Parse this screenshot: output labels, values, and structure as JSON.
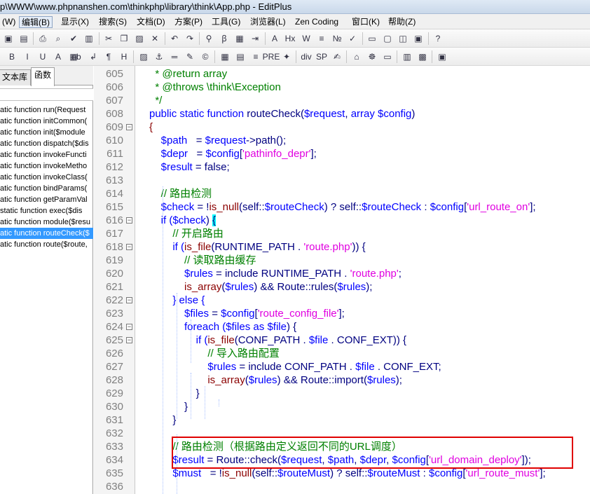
{
  "window": {
    "title": "p\\WWW\\www.phpnanshen.com\\thinkphp\\library\\think\\App.php - EditPlus"
  },
  "menubar": {
    "items": [
      {
        "label": "(W)",
        "active": false
      },
      {
        "label": "编辑(B)",
        "active": true
      },
      {
        "label": "显示(X)",
        "active": false
      },
      {
        "label": "搜索(S)",
        "active": false
      },
      {
        "label": "文档(D)",
        "active": false
      },
      {
        "label": "方案(P)",
        "active": false
      },
      {
        "label": "工具(G)",
        "active": false
      },
      {
        "label": "浏览器(L)",
        "active": false
      },
      {
        "label": "Zen Coding",
        "active": false
      },
      {
        "label": "窗口(K)",
        "active": false
      },
      {
        "label": "帮助(Z)",
        "active": false
      }
    ]
  },
  "toolbar1": {
    "buttons": [
      {
        "icon": "save-icon",
        "glyph": "▣"
      },
      {
        "icon": "save-all-icon",
        "glyph": "▤"
      },
      {
        "icon": "print-icon",
        "glyph": "⎙"
      },
      {
        "icon": "print-preview-icon",
        "glyph": "⌕"
      },
      {
        "icon": "spell-check-icon",
        "glyph": "✔"
      },
      {
        "icon": "page-setup-icon",
        "glyph": "▥"
      },
      {
        "icon": "cut-icon",
        "glyph": "✂"
      },
      {
        "icon": "copy-icon",
        "glyph": "❐"
      },
      {
        "icon": "paste-icon",
        "glyph": "▨"
      },
      {
        "icon": "delete-icon",
        "glyph": "✕"
      },
      {
        "icon": "undo-icon",
        "glyph": "↶"
      },
      {
        "icon": "redo-icon",
        "glyph": "↷"
      },
      {
        "icon": "find-icon",
        "glyph": "⚲"
      },
      {
        "icon": "replace-icon",
        "glyph": "ꞵ"
      },
      {
        "icon": "find-in-files-icon",
        "glyph": "▦"
      },
      {
        "icon": "goto-line-icon",
        "glyph": "⇥"
      },
      {
        "icon": "font-icon",
        "glyph": "A"
      },
      {
        "icon": "hex-view-icon",
        "glyph": "Hx"
      },
      {
        "icon": "word-wrap-icon",
        "glyph": "W"
      },
      {
        "icon": "ruler-icon",
        "glyph": "≡"
      },
      {
        "icon": "line-number-icon",
        "glyph": "№"
      },
      {
        "icon": "spell-icon",
        "glyph": "✓"
      },
      {
        "icon": "window-list-icon",
        "glyph": "▭"
      },
      {
        "icon": "preview-icon",
        "glyph": "▢"
      },
      {
        "icon": "browser-icon",
        "glyph": "◫"
      },
      {
        "icon": "clip-icon",
        "glyph": "▣"
      },
      {
        "icon": "help-cursor-icon",
        "glyph": "?"
      }
    ]
  },
  "toolbar2": {
    "buttons": [
      {
        "icon": "bold-icon",
        "glyph": "B"
      },
      {
        "icon": "italic-icon",
        "glyph": "I"
      },
      {
        "icon": "underline-icon",
        "glyph": "U"
      },
      {
        "icon": "font-color-icon",
        "glyph": "A"
      },
      {
        "icon": "color-grid-icon",
        "glyph": "▦"
      },
      {
        "icon": "nbsp-icon",
        "glyph": "nb"
      },
      {
        "icon": "line-break-icon",
        "glyph": "↲"
      },
      {
        "icon": "paragraph-icon",
        "glyph": "¶"
      },
      {
        "icon": "heading-icon",
        "glyph": "H"
      },
      {
        "icon": "image-icon",
        "glyph": "▨"
      },
      {
        "icon": "anchor-icon",
        "glyph": "⚓"
      },
      {
        "icon": "hr-icon",
        "glyph": "═"
      },
      {
        "icon": "edit-icon",
        "glyph": "✎"
      },
      {
        "icon": "comment-icon",
        "glyph": "©"
      },
      {
        "icon": "table-icon",
        "glyph": "▦"
      },
      {
        "icon": "form-icon",
        "glyph": "▤"
      },
      {
        "icon": "center-icon",
        "glyph": "≡"
      },
      {
        "icon": "pre-icon",
        "glyph": "PRE"
      },
      {
        "icon": "script-icon",
        "glyph": "✦"
      },
      {
        "icon": "div-icon",
        "glyph": "div"
      },
      {
        "icon": "span-icon",
        "glyph": "SP"
      },
      {
        "icon": "clip-library-icon",
        "glyph": "✍"
      },
      {
        "icon": "tag-icon",
        "glyph": "⌂"
      },
      {
        "icon": "css-icon",
        "glyph": "☸"
      },
      {
        "icon": "frame-icon",
        "glyph": "▭"
      },
      {
        "icon": "layout-icon",
        "glyph": "▥"
      },
      {
        "icon": "palette-icon",
        "glyph": "▩"
      },
      {
        "icon": "browser-view-icon",
        "glyph": "▣"
      }
    ]
  },
  "sidebar": {
    "tabs": [
      {
        "label": "文本库",
        "active": false
      },
      {
        "label": "函数",
        "active": true
      }
    ],
    "functions": [
      {
        "label": "atic function run(Request",
        "selected": false
      },
      {
        "label": "atic function initCommon(",
        "selected": false
      },
      {
        "label": "atic function init($module",
        "selected": false
      },
      {
        "label": "atic function dispatch($dis",
        "selected": false
      },
      {
        "label": "atic function invokeFuncti",
        "selected": false
      },
      {
        "label": "atic function invokeMetho",
        "selected": false
      },
      {
        "label": "atic function invokeClass(",
        "selected": false
      },
      {
        "label": "atic function bindParams(",
        "selected": false
      },
      {
        "label": "atic function getParamVal",
        "selected": false
      },
      {
        "label": " static function exec($dis",
        "selected": false
      },
      {
        "label": "atic function module($resu",
        "selected": false
      },
      {
        "label": "atic function routeCheck($",
        "selected": true
      },
      {
        "label": "atic function route($route,",
        "selected": false
      }
    ]
  },
  "editor": {
    "colors": {
      "keyword": "#0000ff",
      "variable": "#0000ff",
      "string": "#e000e0",
      "comment": "#008000",
      "function": "#8b0000",
      "text": "#000080"
    },
    "lines": [
      {
        "n": "605",
        "fold": "",
        "tokens": [
          {
            "t": "  * @return array",
            "c": "comment"
          }
        ]
      },
      {
        "n": "606",
        "fold": "",
        "tokens": [
          {
            "t": "  * @throws \\think\\Exception",
            "c": "comment"
          }
        ]
      },
      {
        "n": "607",
        "fold": "",
        "tokens": [
          {
            "t": "  */",
            "c": "comment"
          }
        ]
      },
      {
        "n": "608",
        "fold": "",
        "tokens": [
          {
            "t": "public static function ",
            "c": "keyword"
          },
          {
            "t": "routeCheck",
            "c": "text"
          },
          {
            "t": "(",
            "c": "text"
          },
          {
            "t": "$request",
            "c": "variable"
          },
          {
            "t": ", ",
            "c": "text"
          },
          {
            "t": "array ",
            "c": "keyword"
          },
          {
            "t": "$config",
            "c": "variable"
          },
          {
            "t": ")",
            "c": "text"
          }
        ]
      },
      {
        "n": "609",
        "fold": "−",
        "tokens": [
          {
            "t": "{",
            "c": "function"
          }
        ]
      },
      {
        "n": "610",
        "fold": "",
        "tokens": [
          {
            "t": "    $path",
            "c": "variable"
          },
          {
            "t": "   = ",
            "c": "text"
          },
          {
            "t": "$request",
            "c": "variable"
          },
          {
            "t": "->path();",
            "c": "text"
          }
        ]
      },
      {
        "n": "611",
        "fold": "",
        "tokens": [
          {
            "t": "    $depr",
            "c": "variable"
          },
          {
            "t": "   = ",
            "c": "text"
          },
          {
            "t": "$config",
            "c": "variable"
          },
          {
            "t": "[",
            "c": "text"
          },
          {
            "t": "'pathinfo_depr'",
            "c": "string"
          },
          {
            "t": "];",
            "c": "text"
          }
        ]
      },
      {
        "n": "612",
        "fold": "",
        "tokens": [
          {
            "t": "    $result",
            "c": "variable"
          },
          {
            "t": " = false;",
            "c": "text"
          }
        ]
      },
      {
        "n": "613",
        "fold": "",
        "tokens": []
      },
      {
        "n": "614",
        "fold": "",
        "tokens": [
          {
            "t": "    // 路由检测",
            "c": "comment"
          }
        ]
      },
      {
        "n": "615",
        "fold": "",
        "tokens": [
          {
            "t": "    $check",
            "c": "variable"
          },
          {
            "t": " = !",
            "c": "text"
          },
          {
            "t": "is_null",
            "c": "function"
          },
          {
            "t": "(self::",
            "c": "text"
          },
          {
            "t": "$routeCheck",
            "c": "variable"
          },
          {
            "t": ") ? self::",
            "c": "text"
          },
          {
            "t": "$routeCheck",
            "c": "variable"
          },
          {
            "t": " : ",
            "c": "text"
          },
          {
            "t": "$config",
            "c": "variable"
          },
          {
            "t": "[",
            "c": "text"
          },
          {
            "t": "'url_route_on'",
            "c": "string"
          },
          {
            "t": "];",
            "c": "text"
          }
        ]
      },
      {
        "n": "616",
        "fold": "−",
        "tokens": [
          {
            "t": "    if (",
            "c": "keyword"
          },
          {
            "t": "$check",
            "c": "variable"
          },
          {
            "t": ") ",
            "c": "text"
          },
          {
            "t": "{",
            "c": "bracket"
          }
        ]
      },
      {
        "n": "617",
        "fold": "",
        "tokens": [
          {
            "t": "        // 开启路由",
            "c": "comment"
          }
        ]
      },
      {
        "n": "618",
        "fold": "−",
        "tokens": [
          {
            "t": "        if (",
            "c": "keyword"
          },
          {
            "t": "is_file",
            "c": "function"
          },
          {
            "t": "(RUNTIME_PATH . ",
            "c": "text"
          },
          {
            "t": "'route.php'",
            "c": "string"
          },
          {
            "t": ")) {",
            "c": "text"
          }
        ]
      },
      {
        "n": "619",
        "fold": "",
        "tokens": [
          {
            "t": "            // 读取路由缓存",
            "c": "comment"
          }
        ]
      },
      {
        "n": "620",
        "fold": "",
        "tokens": [
          {
            "t": "            $rules",
            "c": "variable"
          },
          {
            "t": " = include RUNTIME_PATH . ",
            "c": "text"
          },
          {
            "t": "'route.php'",
            "c": "string"
          },
          {
            "t": ";",
            "c": "text"
          }
        ]
      },
      {
        "n": "621",
        "fold": "",
        "tokens": [
          {
            "t": "            is_array",
            "c": "function"
          },
          {
            "t": "(",
            "c": "text"
          },
          {
            "t": "$rules",
            "c": "variable"
          },
          {
            "t": ") && Route::rules(",
            "c": "text"
          },
          {
            "t": "$rules",
            "c": "variable"
          },
          {
            "t": ");",
            "c": "text"
          }
        ]
      },
      {
        "n": "622",
        "fold": "−",
        "tokens": [
          {
            "t": "        } else {",
            "c": "keyword"
          }
        ]
      },
      {
        "n": "623",
        "fold": "",
        "tokens": [
          {
            "t": "            $files",
            "c": "variable"
          },
          {
            "t": " = ",
            "c": "text"
          },
          {
            "t": "$config",
            "c": "variable"
          },
          {
            "t": "[",
            "c": "text"
          },
          {
            "t": "'route_config_file'",
            "c": "string"
          },
          {
            "t": "];",
            "c": "text"
          }
        ]
      },
      {
        "n": "624",
        "fold": "−",
        "tokens": [
          {
            "t": "            foreach (",
            "c": "keyword"
          },
          {
            "t": "$files",
            "c": "variable"
          },
          {
            "t": " as ",
            "c": "keyword"
          },
          {
            "t": "$file",
            "c": "variable"
          },
          {
            "t": ") {",
            "c": "text"
          }
        ]
      },
      {
        "n": "625",
        "fold": "−",
        "tokens": [
          {
            "t": "                if (",
            "c": "keyword"
          },
          {
            "t": "is_file",
            "c": "function"
          },
          {
            "t": "(CONF_PATH . ",
            "c": "text"
          },
          {
            "t": "$file",
            "c": "variable"
          },
          {
            "t": " . CONF_EXT)) {",
            "c": "text"
          }
        ]
      },
      {
        "n": "626",
        "fold": "",
        "tokens": [
          {
            "t": "                    // 导入路由配置",
            "c": "comment"
          }
        ]
      },
      {
        "n": "627",
        "fold": "",
        "tokens": [
          {
            "t": "                    $rules",
            "c": "variable"
          },
          {
            "t": " = include CONF_PATH . ",
            "c": "text"
          },
          {
            "t": "$file",
            "c": "variable"
          },
          {
            "t": " . CONF_EXT;",
            "c": "text"
          }
        ]
      },
      {
        "n": "628",
        "fold": "",
        "tokens": [
          {
            "t": "                    is_array",
            "c": "function"
          },
          {
            "t": "(",
            "c": "text"
          },
          {
            "t": "$rules",
            "c": "variable"
          },
          {
            "t": ") && Route::import(",
            "c": "text"
          },
          {
            "t": "$rules",
            "c": "variable"
          },
          {
            "t": ");",
            "c": "text"
          }
        ]
      },
      {
        "n": "629",
        "fold": "",
        "tokens": [
          {
            "t": "                }",
            "c": "text"
          }
        ]
      },
      {
        "n": "630",
        "fold": "",
        "tokens": [
          {
            "t": "            }",
            "c": "text"
          }
        ]
      },
      {
        "n": "631",
        "fold": "",
        "tokens": [
          {
            "t": "        }",
            "c": "text"
          }
        ]
      },
      {
        "n": "632",
        "fold": "",
        "tokens": []
      },
      {
        "n": "633",
        "fold": "",
        "tokens": [
          {
            "t": "        // 路由检测（根据路由定义返回不同的URL调度）",
            "c": "comment"
          }
        ]
      },
      {
        "n": "634",
        "fold": "",
        "tokens": [
          {
            "t": "        $result",
            "c": "variable"
          },
          {
            "t": " = Route::check(",
            "c": "text"
          },
          {
            "t": "$request",
            "c": "variable"
          },
          {
            "t": ", ",
            "c": "text"
          },
          {
            "t": "$path",
            "c": "variable"
          },
          {
            "t": ", ",
            "c": "text"
          },
          {
            "t": "$depr",
            "c": "variable"
          },
          {
            "t": ", ",
            "c": "text"
          },
          {
            "t": "$config",
            "c": "variable"
          },
          {
            "t": "[",
            "c": "text"
          },
          {
            "t": "'url_domain_deploy'",
            "c": "string"
          },
          {
            "t": "]);",
            "c": "text"
          }
        ]
      },
      {
        "n": "635",
        "fold": "",
        "tokens": [
          {
            "t": "        $must",
            "c": "variable"
          },
          {
            "t": "   = !",
            "c": "text"
          },
          {
            "t": "is_null",
            "c": "function"
          },
          {
            "t": "(self::",
            "c": "text"
          },
          {
            "t": "$routeMust",
            "c": "variable"
          },
          {
            "t": ") ? self::",
            "c": "text"
          },
          {
            "t": "$routeMust",
            "c": "variable"
          },
          {
            "t": " : ",
            "c": "text"
          },
          {
            "t": "$config",
            "c": "variable"
          },
          {
            "t": "[",
            "c": "text"
          },
          {
            "t": "'url_route_must'",
            "c": "string"
          },
          {
            "t": "];",
            "c": "text"
          }
        ]
      },
      {
        "n": "636",
        "fold": "",
        "tokens": []
      }
    ]
  }
}
